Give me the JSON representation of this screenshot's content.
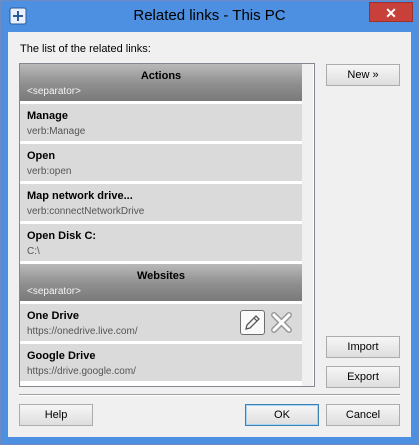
{
  "window": {
    "title": "Related links - This PC",
    "close_glyph": "✕"
  },
  "list_caption": "The list of the related links:",
  "items": [
    {
      "type": "separator",
      "name": "Actions",
      "sub": "<separator>"
    },
    {
      "type": "link",
      "name": "Manage",
      "sub": "verb:Manage"
    },
    {
      "type": "link",
      "name": "Open",
      "sub": "verb:open"
    },
    {
      "type": "link",
      "name": "Map network drive...",
      "sub": "verb:connectNetworkDrive"
    },
    {
      "type": "link",
      "name": "Open Disk C:",
      "sub": "C:\\"
    },
    {
      "type": "separator",
      "name": "Websites",
      "sub": "<separator>"
    },
    {
      "type": "link",
      "name": "One Drive",
      "sub": "https://onedrive.live.com/"
    },
    {
      "type": "link",
      "name": "Google Drive",
      "sub": "https://drive.google.com/"
    }
  ],
  "buttons": {
    "new": "New »",
    "import": "Import",
    "export": "Export",
    "help": "Help",
    "ok": "OK",
    "cancel": "Cancel"
  }
}
